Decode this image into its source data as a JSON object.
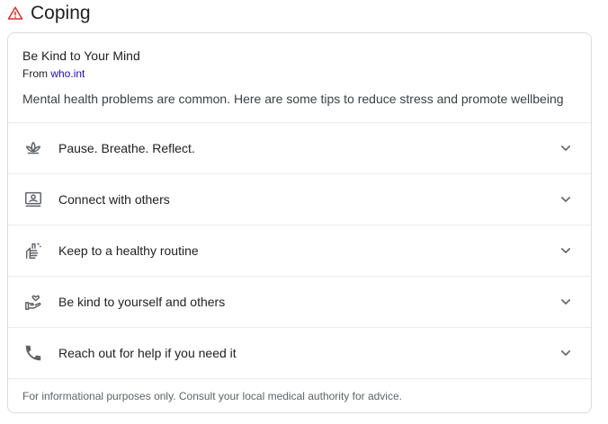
{
  "section": {
    "title": "Coping",
    "icon": "warning-triangle-icon",
    "icon_color": "#d93025"
  },
  "card": {
    "title": "Be Kind to Your Mind",
    "source_prefix": "From",
    "source_link": "who.int",
    "link_color": "#1a0dab",
    "description": "Mental health problems are common. Here are some tips to reduce stress and promote wellbeing",
    "items": [
      {
        "label": "Pause. Breathe. Reflect.",
        "icon": "lotus-icon"
      },
      {
        "label": "Connect with others",
        "icon": "video-contact-icon"
      },
      {
        "label": "Keep to a healthy routine",
        "icon": "washing-hands-icon"
      },
      {
        "label": "Be kind to yourself and others",
        "icon": "hand-heart-icon"
      },
      {
        "label": "Reach out for help if you need it",
        "icon": "phone-icon"
      }
    ],
    "footer": "For informational purposes only. Consult your local medical authority for advice."
  }
}
